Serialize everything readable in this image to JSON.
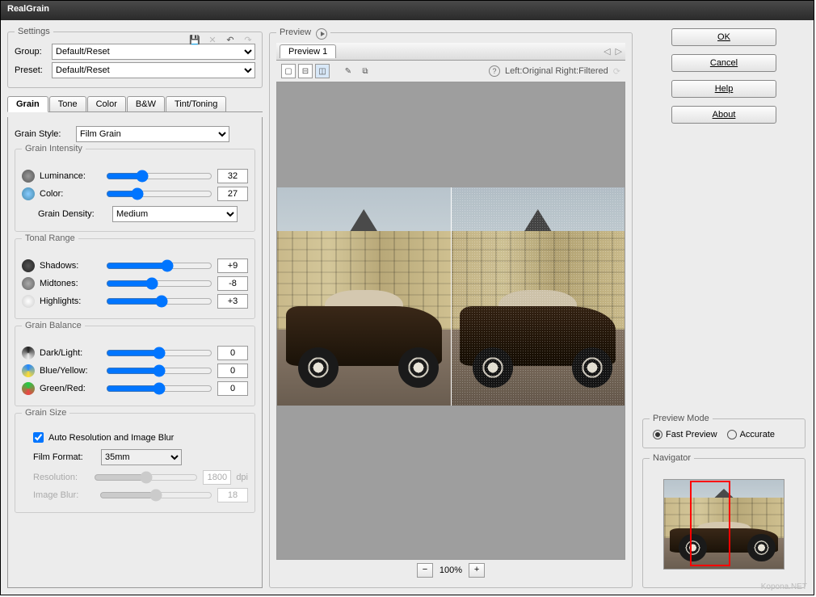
{
  "title": "RealGrain",
  "settings": {
    "legend": "Settings",
    "group_label": "Group:",
    "group_value": "Default/Reset",
    "preset_label": "Preset:",
    "preset_value": "Default/Reset"
  },
  "tabs": [
    "Grain",
    "Tone",
    "Color",
    "B&W",
    "Tint/Toning"
  ],
  "grain": {
    "style_label": "Grain Style:",
    "style_value": "Film Grain",
    "intensity": {
      "legend": "Grain Intensity",
      "luminance_label": "Luminance:",
      "luminance_value": "32",
      "color_label": "Color:",
      "color_value": "27",
      "density_label": "Grain Density:",
      "density_value": "Medium"
    },
    "tonal": {
      "legend": "Tonal Range",
      "shadows_label": "Shadows:",
      "shadows_value": "+9",
      "midtones_label": "Midtones:",
      "midtones_value": "-8",
      "highlights_label": "Highlights:",
      "highlights_value": "+3"
    },
    "balance": {
      "legend": "Grain Balance",
      "darklight_label": "Dark/Light:",
      "darklight_value": "0",
      "blueyellow_label": "Blue/Yellow:",
      "blueyellow_value": "0",
      "greenred_label": "Green/Red:",
      "greenred_value": "0"
    },
    "size": {
      "legend": "Grain Size",
      "auto_label": "Auto Resolution and Image Blur",
      "film_label": "Film Format:",
      "film_value": "35mm",
      "resolution_label": "Resolution:",
      "resolution_value": "1800",
      "resolution_unit": "dpi",
      "blur_label": "Image Blur:",
      "blur_value": "18"
    }
  },
  "preview": {
    "legend": "Preview",
    "tab": "Preview 1",
    "compare_text": "Left:Original Right:Filtered",
    "zoom": "100%"
  },
  "buttons": {
    "ok": "OK",
    "cancel": "Cancel",
    "help": "Help",
    "about": "About"
  },
  "preview_mode": {
    "legend": "Preview Mode",
    "fast": "Fast Preview",
    "accurate": "Accurate"
  },
  "navigator": {
    "legend": "Navigator"
  },
  "watermark": "Kopona.NET"
}
